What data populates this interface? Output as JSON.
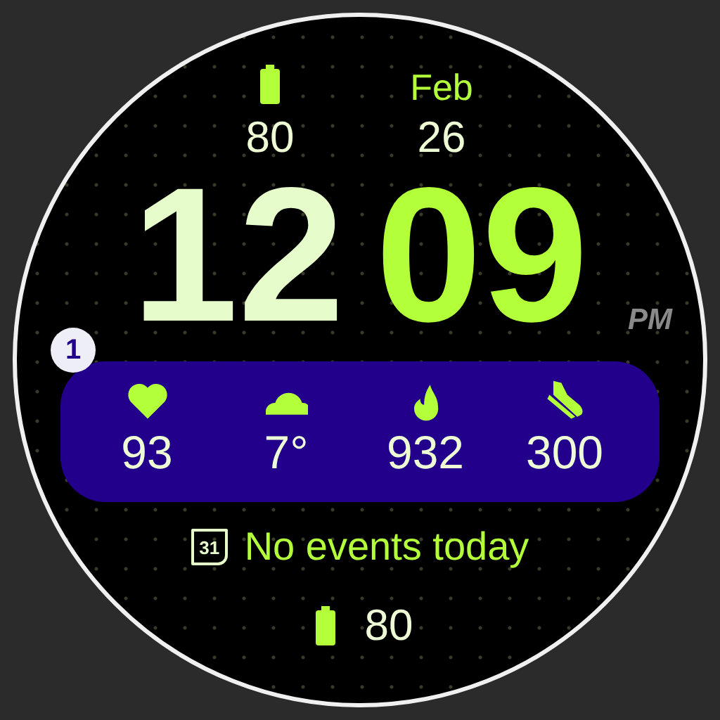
{
  "battery_top": {
    "value": "80"
  },
  "date": {
    "month": "Feb",
    "day": "26"
  },
  "time": {
    "hours": "12",
    "minutes": "09",
    "period": "PM"
  },
  "complication_badge": "1",
  "complications": [
    {
      "kind": "heart",
      "value": "93"
    },
    {
      "kind": "cloud",
      "value": "7°"
    },
    {
      "kind": "flame",
      "value": "932"
    },
    {
      "kind": "shoe",
      "value": "300"
    }
  ],
  "calendar": {
    "icon_day": "31",
    "text": "No events today"
  },
  "battery_bottom": {
    "value": "80"
  }
}
